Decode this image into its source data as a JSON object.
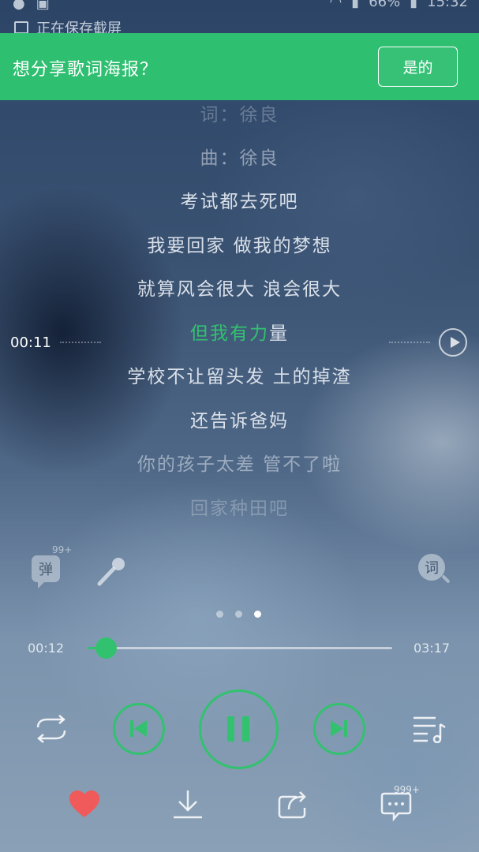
{
  "status_bar": {
    "battery": "66%",
    "time": "15:32",
    "notification": "正在保存截屏"
  },
  "share_prompt": {
    "text": "想分享歌词海报？",
    "confirm_label": "是的"
  },
  "lyrics": [
    {
      "text": "词：徐良",
      "style": "faded2"
    },
    {
      "text": "曲：徐良",
      "style": "faded1"
    },
    {
      "text": "考试都去死吧",
      "style": "normal"
    },
    {
      "text": "我要回家 做我的梦想",
      "style": "normal"
    },
    {
      "text": "就算风会很大 浪会很大",
      "style": "normal"
    },
    {
      "text": "但我有力量",
      "style": "active",
      "sung": "但我有力",
      "unsung": "量"
    },
    {
      "text": "学校不让留头发 土的掉渣",
      "style": "normal"
    },
    {
      "text": "还告诉爸妈",
      "style": "normal"
    },
    {
      "text": "你的孩子太差 管不了啦",
      "style": "faded1"
    },
    {
      "text": "回家种田吧",
      "style": "faded2"
    }
  ],
  "seek_marker": {
    "time": "00:11"
  },
  "tools": {
    "danmu_label": "弹",
    "danmu_badge": "99+",
    "lyrics_search_label": "词"
  },
  "pager": {
    "count": 3,
    "active_index": 2
  },
  "progress": {
    "current": "00:12",
    "total": "03:17",
    "fraction": 0.063
  },
  "comments_badge": "999+",
  "colors": {
    "accent": "#32c26f",
    "banner": "#2fbf71",
    "favorite": "#f05a5a"
  }
}
